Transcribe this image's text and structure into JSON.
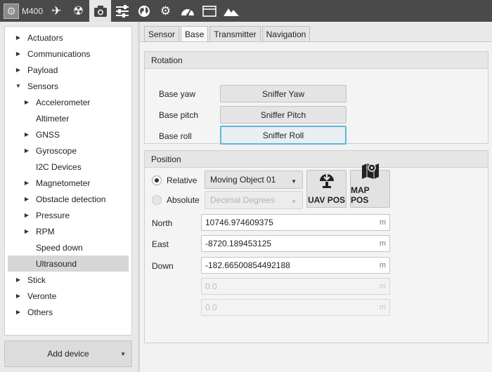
{
  "toolbar": {
    "device_label": "M400",
    "icons": [
      "chip-icon",
      "airplane-icon",
      "radiation-icon",
      "camera-icon",
      "sliders-icon",
      "globe-icon",
      "gears-icon",
      "gauge-icon",
      "window-icon",
      "mountain-icon"
    ]
  },
  "tree": {
    "items": [
      {
        "label": "Actuators",
        "arrow": "▶"
      },
      {
        "label": "Communications",
        "arrow": "▶"
      },
      {
        "label": "Payload",
        "arrow": "▶"
      },
      {
        "label": "Sensors",
        "arrow": "▼"
      },
      {
        "label": "Accelerometer",
        "arrow": "▶"
      },
      {
        "label": "Altimeter",
        "arrow": ""
      },
      {
        "label": "GNSS",
        "arrow": "▶"
      },
      {
        "label": "Gyroscope",
        "arrow": "▶"
      },
      {
        "label": "I2C Devices",
        "arrow": ""
      },
      {
        "label": "Magnetometer",
        "arrow": "▶"
      },
      {
        "label": "Obstacle detection",
        "arrow": "▶"
      },
      {
        "label": "Pressure",
        "arrow": "▶"
      },
      {
        "label": "RPM",
        "arrow": "▶"
      },
      {
        "label": "Speed down",
        "arrow": ""
      },
      {
        "label": "Ultrasound",
        "arrow": ""
      },
      {
        "label": "Stick",
        "arrow": "▶"
      },
      {
        "label": "Veronte",
        "arrow": "▶"
      },
      {
        "label": "Others",
        "arrow": "▶"
      }
    ],
    "add_device_label": "Add device",
    "caret": "▼"
  },
  "tabs": [
    "Sensor",
    "Base",
    "Transmitter",
    "Navigation"
  ],
  "rotation": {
    "title": "Rotation",
    "rows": [
      {
        "label": "Base yaw",
        "button": "Sniffer Yaw"
      },
      {
        "label": "Base pitch",
        "button": "Sniffer Pitch"
      },
      {
        "label": "Base roll",
        "button": "Sniffer Roll"
      }
    ]
  },
  "position": {
    "title": "Position",
    "relative_label": "Relative",
    "absolute_label": "Absolute",
    "relative_value": "Moving Object 01",
    "absolute_value": "Decimal Degrees",
    "uav_pos_label": "UAV POS",
    "map_pos_label": "MAP POS",
    "fields": [
      {
        "label": "North",
        "value": "10746.974609375",
        "unit": "m"
      },
      {
        "label": "East",
        "value": "-8720.189453125",
        "unit": "m"
      },
      {
        "label": "Down",
        "value": "-182.66500854492188",
        "unit": "m"
      },
      {
        "label": "",
        "value": "0.0",
        "unit": "m"
      },
      {
        "label": "",
        "value": "0.0",
        "unit": "m"
      }
    ]
  }
}
